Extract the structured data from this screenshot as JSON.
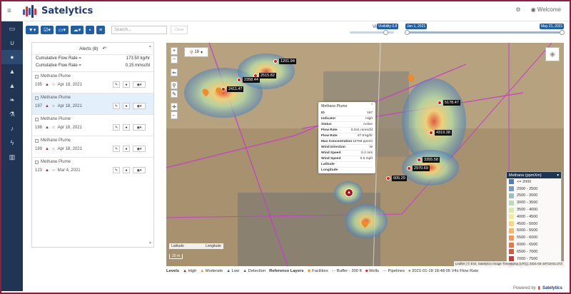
{
  "app": {
    "name": "Satelytics",
    "welcome": "Welcome"
  },
  "colors": {
    "accent": "#1f5fa8",
    "sidebar": "#1f3553",
    "frame": "#8b1e3f"
  },
  "sidebar": {
    "items": [
      "folder-icon",
      "magnet-icon",
      "droplet-icon",
      "warning-icon",
      "alert-icon",
      "leaf-icon",
      "flask-icon",
      "bell-icon",
      "bolt-icon",
      "chart-icon"
    ]
  },
  "toolbar": {
    "search_placeholder": "Search...",
    "clear": "Clear",
    "visibility_label": "Visibility",
    "visibility_value": "Visibility 0.8",
    "date_start": "Jan 1, 2021",
    "date_end": "May 21, 2021",
    "visibility_level": 0.8
  },
  "alerts": {
    "title": "Alerts (8)",
    "cumulative": [
      {
        "label": "Cumulative Flow Rate =",
        "value": "173.50 kg/hr"
      },
      {
        "label": "Cumulative Flow Rate =",
        "value": "0.15 mmscfd"
      }
    ],
    "items": [
      {
        "title": "Methane Plume",
        "id": "195",
        "date": "Apr 18, 2021",
        "selected": false
      },
      {
        "title": "Methane Plume",
        "id": "197",
        "date": "Apr 18, 2021",
        "selected": true
      },
      {
        "title": "Methane Plume",
        "id": "198",
        "date": "Apr 18, 2021",
        "selected": false
      },
      {
        "title": "Methane Plume",
        "id": "199",
        "date": "Apr 18, 2021",
        "selected": false
      },
      {
        "title": "Methane Plume",
        "id": "123",
        "date": "Mar 4, 2021",
        "selected": false
      }
    ]
  },
  "map": {
    "zoom_box": "18",
    "labels": [
      "1201.94",
      "2515.82",
      "2358.44",
      "2411.47",
      "5178.47",
      "4319.38",
      "3355.58",
      "2970.69",
      "605.29"
    ],
    "scale": "20 m",
    "lat_label": "Latitude",
    "lon_label": "Longitude",
    "attribution": "Leaflet | © Esri, Satelytics Image Timestamp (UTC): 2021-04-18T19:51:27Z"
  },
  "popup": {
    "title": "Methane Plume",
    "rows": [
      {
        "k": "ID",
        "v": "197"
      },
      {
        "k": "Indicator",
        "v": "High"
      },
      {
        "k": "Status",
        "v": "Active"
      },
      {
        "k": "Flow Rate",
        "v": "0.041 mmscfd"
      },
      {
        "k": "Flow Rate",
        "v": "47.8 kg/hr"
      },
      {
        "k": "Max Concentration",
        "v": "10759 ppmm"
      },
      {
        "k": "Wind Direction",
        "v": "W"
      },
      {
        "k": "Wind Speed",
        "v": "0.2 m/s"
      },
      {
        "k": "Wind Speed",
        "v": "0.5 mph"
      },
      {
        "k": "Latitude",
        "v": ""
      },
      {
        "k": "Longitude",
        "v": ""
      }
    ]
  },
  "legend": {
    "title": "Methane (ppmXm)",
    "rows": [
      {
        "label": "<= 2000",
        "color": "#4a7fbf"
      },
      {
        "label": "2000 - 2500",
        "color": "#6f9fd0"
      },
      {
        "label": "2500 - 3000",
        "color": "#8fc6c2"
      },
      {
        "label": "3000 - 3500",
        "color": "#b8e0a8"
      },
      {
        "label": "3500 - 4000",
        "color": "#d7ef9a"
      },
      {
        "label": "4000 - 4500",
        "color": "#f2f08a"
      },
      {
        "label": "4500 - 5000",
        "color": "#f8d879"
      },
      {
        "label": "5000 - 5500",
        "color": "#f7b766"
      },
      {
        "label": "5500 - 6000",
        "color": "#f39655"
      },
      {
        "label": "6000 - 6500",
        "color": "#ee7446"
      },
      {
        "label": "6500 - 7000",
        "color": "#e4523a"
      },
      {
        "label": "7000 - 7500",
        "color": "#d6342e"
      },
      {
        "label": "> 7500",
        "color": "#c01c24"
      }
    ]
  },
  "bottombar": {
    "levels": "Levels",
    "high": "High",
    "moderate": "Moderate",
    "low": "Low",
    "detection": "Detection",
    "ref": "Reference Layers",
    "facilities": "Facilities",
    "buffer": "Buffer - 300 ft",
    "wells": "Wells",
    "pipelines": "Pipelines",
    "flow": "2021-01-18 18:48:05 V4x Flow Rate"
  },
  "footer": {
    "text": "Powered by",
    "brand": "Satelytics"
  }
}
